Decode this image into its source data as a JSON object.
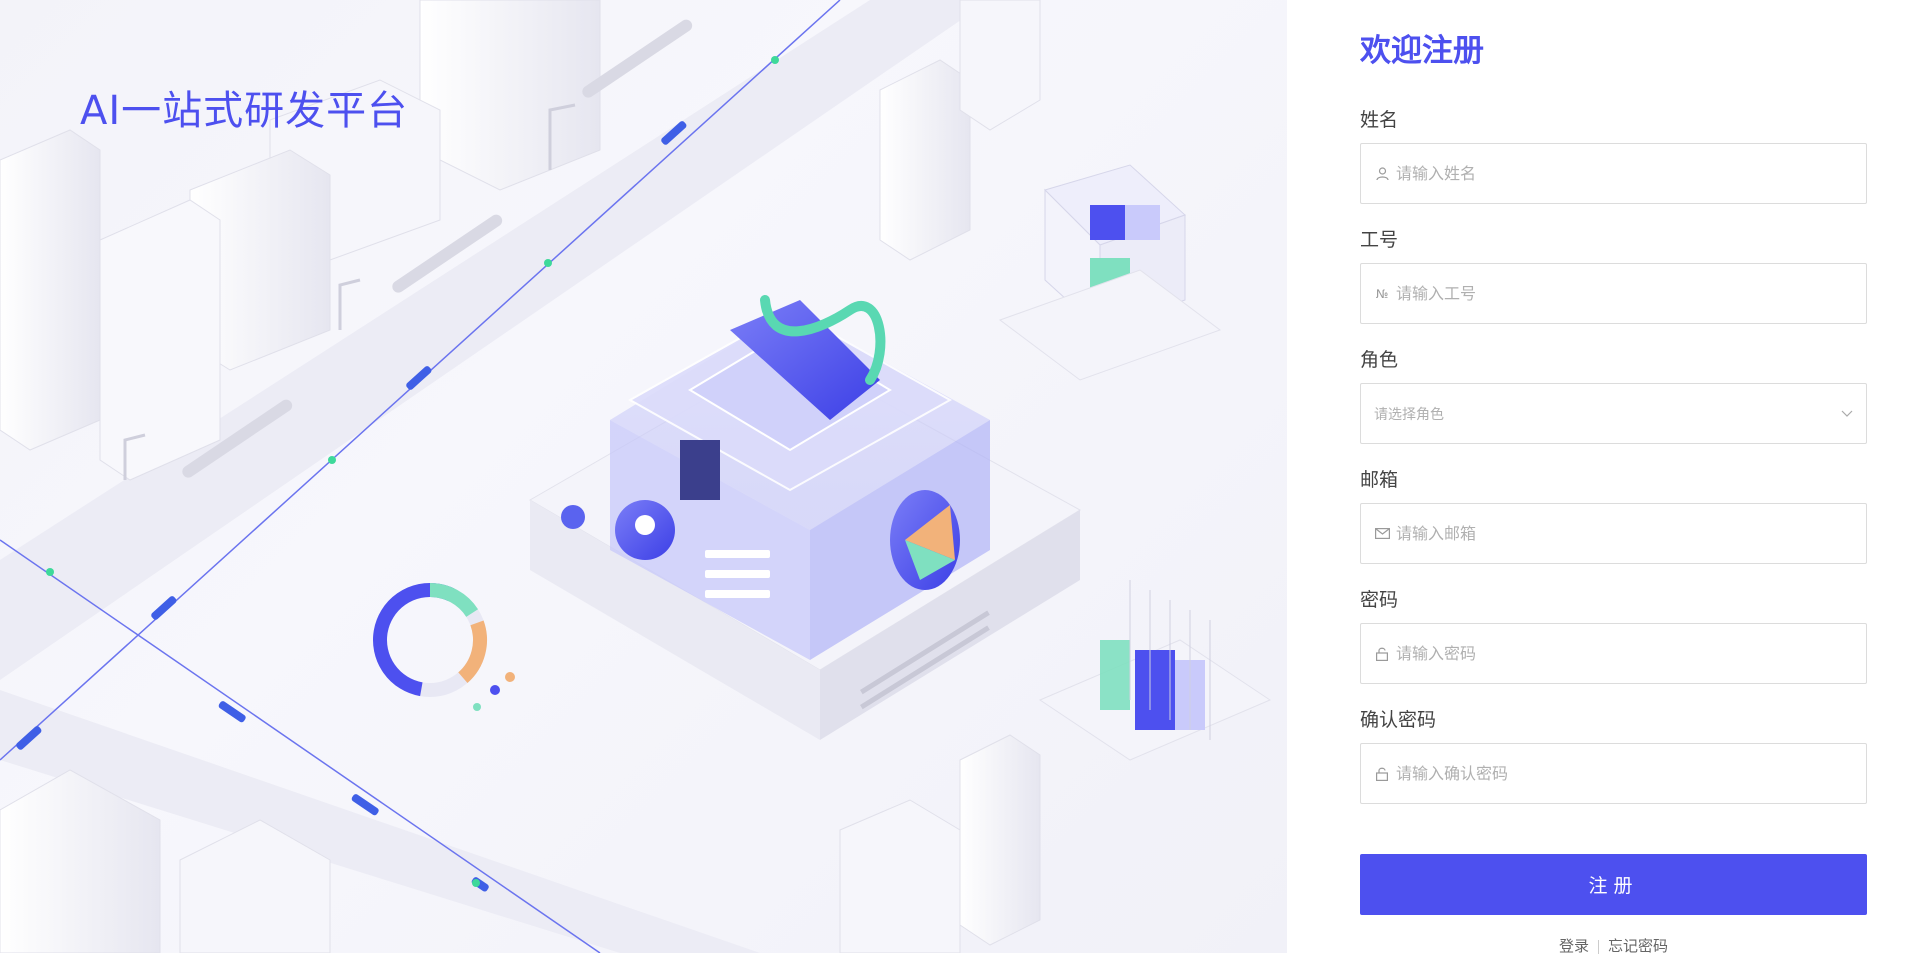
{
  "brand": {
    "title": "AI一站式研发平台"
  },
  "form": {
    "title": "欢迎注册",
    "fields": [
      {
        "label": "姓名",
        "placeholder": "请输入姓名",
        "icon": "user-icon"
      },
      {
        "label": "工号",
        "placeholder": "请输入工号",
        "icon": "number-icon"
      },
      {
        "label": "角色",
        "placeholder": "请选择角色",
        "icon": "chevron-down-icon"
      },
      {
        "label": "邮箱",
        "placeholder": "请输入邮箱",
        "icon": "mail-icon"
      },
      {
        "label": "密码",
        "placeholder": "请输入密码",
        "icon": "lock-icon"
      },
      {
        "label": "确认密码",
        "placeholder": "请输入确认密码",
        "icon": "lock-icon"
      }
    ],
    "submit_label": "注册",
    "login_link": "登录",
    "forgot_link": "忘记密码"
  },
  "colors": {
    "accent": "#4d50ef",
    "border": "#dcdcdc"
  }
}
